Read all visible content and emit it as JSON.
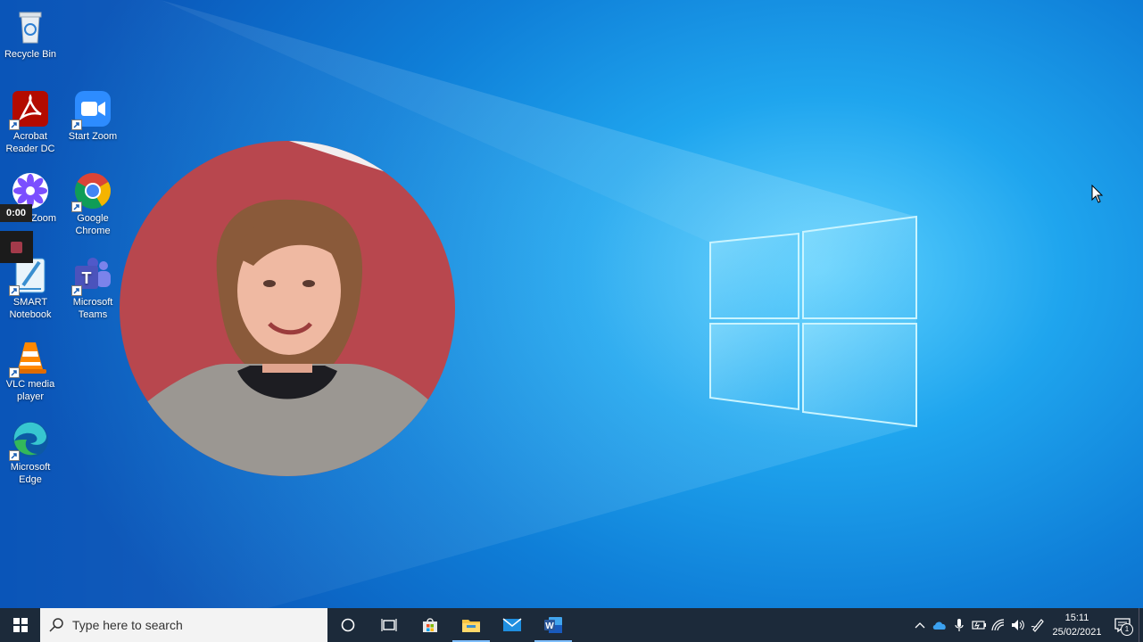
{
  "desktop": {
    "icons": [
      {
        "label": "Recycle Bin",
        "icon": "recycle-bin-icon"
      },
      {
        "label": "Acrobat Reader DC",
        "icon": "acrobat-icon"
      },
      {
        "label": "Start Zoom",
        "icon": "zoom-icon"
      },
      {
        "label": "Zoom",
        "icon": "zoom-flower-icon"
      },
      {
        "label": "Google Chrome",
        "icon": "chrome-icon"
      },
      {
        "label": "SMART Notebook",
        "icon": "smart-notebook-icon"
      },
      {
        "label": "Microsoft Teams",
        "icon": "teams-icon"
      },
      {
        "label": "VLC media player",
        "icon": "vlc-icon"
      },
      {
        "label": "Microsoft Edge",
        "icon": "edge-icon"
      }
    ]
  },
  "recording": {
    "elapsed": "0:00",
    "stop_color": "#a33a4a"
  },
  "taskbar": {
    "search_placeholder": "Type here to search",
    "apps": [
      "cortana-icon",
      "task-view-icon",
      "store-icon",
      "file-explorer-icon",
      "mail-icon",
      "word-icon"
    ],
    "tray": {
      "time": "15:11",
      "date": "25/02/2021",
      "notifications": "1"
    }
  },
  "colors": {
    "taskbar": "#1c2a3a",
    "accent": "#0078d7",
    "wallpaper": "#1fa5ee"
  }
}
